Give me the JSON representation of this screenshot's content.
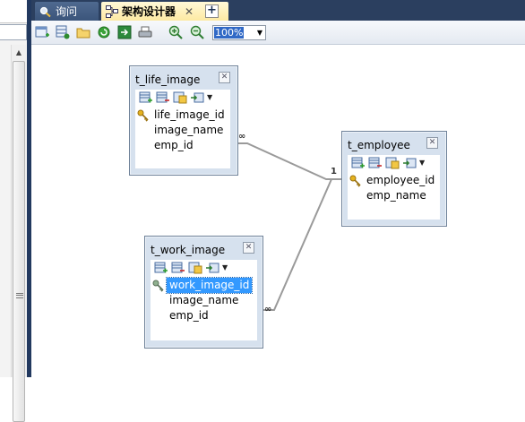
{
  "tabs": [
    {
      "label": "询问"
    },
    {
      "label": "架构设计器",
      "close": "✕"
    }
  ],
  "new_tab": "+",
  "toolbar": {
    "zoom": "100%"
  },
  "tables": [
    {
      "name": "t_life_image",
      "fields": [
        "life_image_id",
        "image_name",
        "emp_id"
      ],
      "primary_key": "life_image_id"
    },
    {
      "name": "t_employee",
      "fields": [
        "employee_id",
        "emp_name"
      ],
      "primary_key": "employee_id"
    },
    {
      "name": "t_work_image",
      "fields": [
        "work_image_id",
        "image_name",
        "emp_id"
      ],
      "primary_key": "work_image_id",
      "selected_field": "work_image_id"
    }
  ],
  "relations": [
    {
      "from": "t_life_image",
      "to": "t_employee",
      "many": "∞",
      "one": "1"
    },
    {
      "from": "t_work_image",
      "to": "t_employee",
      "many": "∞"
    }
  ],
  "colors": {
    "tab_bar": "#2b3f5f",
    "active_tab": "#fde9a2",
    "table_bg": "#d6e1ee",
    "selection": "#3399ff"
  },
  "icons": [
    "search-icon",
    "schema-icon",
    "close-icon",
    "plus-icon",
    "zoom-in-icon",
    "zoom-out-icon",
    "key-icon"
  ]
}
